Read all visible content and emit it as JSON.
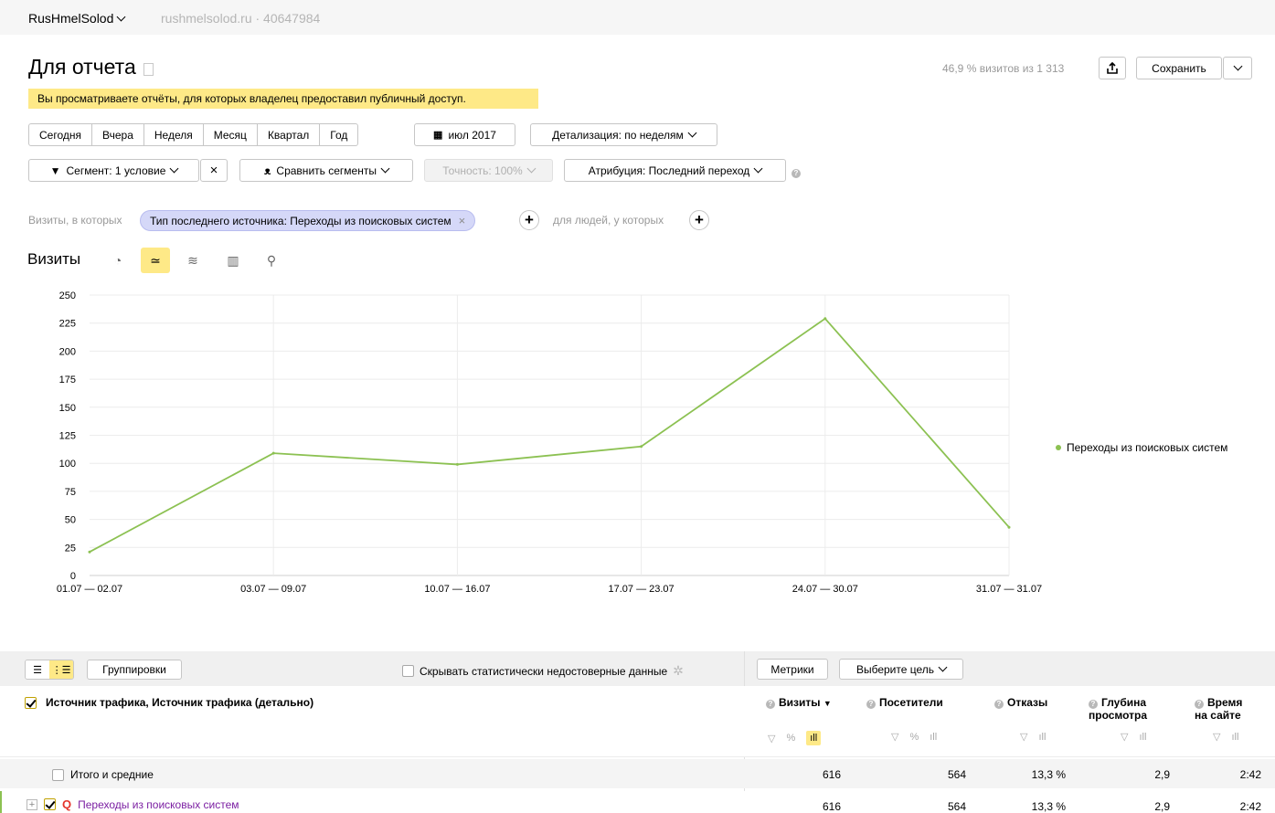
{
  "topbar": {
    "counter_name": "RusHmelSolod",
    "counter_meta": "rushmelsolod.ru · 40647984"
  },
  "page": {
    "title": "Для отчета"
  },
  "header": {
    "visits_share": "46,9 % визитов из 1 313",
    "save_label": "Сохранить"
  },
  "notice": "Вы просматриваете отчёты, для которых владелец предоставил публичный доступ.",
  "periods": [
    "Сегодня",
    "Вчера",
    "Неделя",
    "Месяц",
    "Квартал",
    "Год"
  ],
  "date_picker": "июл 2017",
  "detail": "Детализация: по неделям",
  "filters": {
    "segment": "Сегмент: 1 условие",
    "compare": "Сравнить сегменты",
    "accuracy": "Точность: 100%",
    "attribution": "Атрибуция: Последний переход"
  },
  "conditions": {
    "visits_label": "Визиты, в которых",
    "chip": "Тип последнего источника: Переходы из поисковых систем",
    "people_label": "для людей, у которых"
  },
  "chart_section": {
    "title": "Визиты"
  },
  "chart_data": {
    "type": "line",
    "x": [
      "01.07 — 02.07",
      "03.07 — 09.07",
      "10.07 — 16.07",
      "17.07 — 23.07",
      "24.07 — 30.07",
      "31.07 — 31.07"
    ],
    "series": [
      {
        "name": "Переходы из поисковых систем",
        "values": [
          21,
          109,
          99,
          115,
          229,
          43
        ],
        "color": "#8cc152"
      }
    ],
    "ylim": [
      0,
      250
    ],
    "yticks": [
      0,
      25,
      50,
      75,
      100,
      125,
      150,
      175,
      200,
      225,
      250
    ],
    "grid": true,
    "legend": "right"
  },
  "table": {
    "groupings_label": "Группировки",
    "hide_label": "Скрывать статистически недостоверные данные",
    "metrics_label": "Метрики",
    "goal_label": "Выберите цель",
    "dimension_title": "Источник трафика, Источник трафика (детально)",
    "columns": [
      {
        "line1": "Визиты",
        "line2": "",
        "sort": "▼"
      },
      {
        "line1": "Посетители",
        "line2": ""
      },
      {
        "line1": "Отказы",
        "line2": ""
      },
      {
        "line1": "Глубина",
        "line2": "просмотра"
      },
      {
        "line1": "Время",
        "line2": "на сайте"
      }
    ],
    "total": {
      "label": "Итого и средние",
      "values": [
        "616",
        "564",
        "13,3 %",
        "2,9",
        "2:42"
      ]
    },
    "rows": [
      {
        "label": "Переходы из поисковых систем",
        "values": [
          "616",
          "564",
          "13,3 %",
          "2,9",
          "2:42"
        ]
      }
    ]
  }
}
